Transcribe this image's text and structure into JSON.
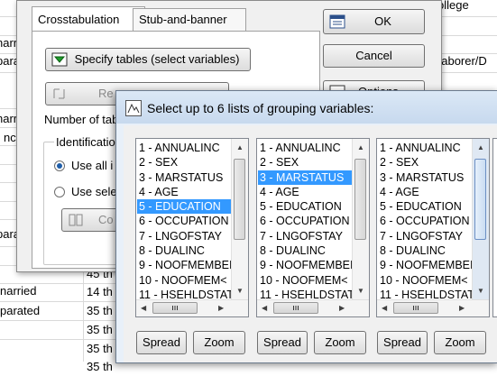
{
  "background": {
    "cells": [
      {
        "id": "college",
        "text": "ollege"
      },
      {
        "id": "laborer",
        "text": "Laborer/D"
      },
      {
        "id": "r1",
        "text": "narri"
      },
      {
        "id": "r2",
        "text": "parated"
      },
      {
        "id": "r3",
        "text": "narri"
      },
      {
        "id": "r4",
        "text": "nc"
      },
      {
        "id": "r5",
        "text": "parat"
      },
      {
        "id": "r6",
        "text": "narried"
      },
      {
        "id": "r7",
        "text": "parated"
      },
      {
        "id": "c1",
        "text": "45 th"
      },
      {
        "id": "c2",
        "text": "14 th"
      },
      {
        "id": "c3",
        "text": "35 th"
      },
      {
        "id": "c4",
        "text": "35 th"
      },
      {
        "id": "c5",
        "text": "35 th"
      },
      {
        "id": "c6",
        "text": "35 th"
      }
    ]
  },
  "dialog1": {
    "tabs": [
      "Crosstabulation",
      "Stub-and-banner"
    ],
    "specify_tables": "Specify tables (select variables)",
    "re_button": "Re",
    "number_label": "Number of tab",
    "ident_label": "Identificatio",
    "radio_use_all": "Use all i",
    "radio_use_sel": "Use sele",
    "co_button": "Co",
    "ok": "OK",
    "cancel": "Cancel",
    "options": "Options"
  },
  "dialog2": {
    "title": "Select up to 6 lists of grouping variables:",
    "lists": [
      {
        "items": [
          "1 - ANNUALINC",
          "2 - SEX",
          "3 - MARSTATUS",
          "4 - AGE",
          "5 - EDUCATION",
          "6 - OCCUPATION",
          "7 - LNGOFSTAY",
          "8 - DUALINC",
          "9 - NOOFMEMBEI",
          "10 - NOOFMEM<",
          "11 - HSEHLDSTAT"
        ],
        "selected": 4
      },
      {
        "items": [
          "1 - ANNUALINC",
          "2 - SEX",
          "3 - MARSTATUS",
          "4 - AGE",
          "5 - EDUCATION",
          "6 - OCCUPATION",
          "7 - LNGOFSTAY",
          "8 - DUALINC",
          "9 - NOOFMEMBEI",
          "10 - NOOFMEM<",
          "11 - HSEHLDSTAT"
        ],
        "selected": 2
      },
      {
        "items": [
          "1 - ANNUALINC",
          "2 - SEX",
          "3 - MARSTATUS",
          "4 - AGE",
          "5 - EDUCATION",
          "6 - OCCUPATION",
          "7 - LNGOFSTAY",
          "8 - DUALINC",
          "9 - NOOFMEMBEI",
          "10 - NOOFMEM<",
          "11 - HSEHLDSTAT"
        ],
        "selected": -1
      }
    ],
    "spread": "Spread",
    "zoom": "Zoom"
  },
  "colors": {
    "selection": "#3399ff",
    "title_bar": "#c7d9ee"
  }
}
